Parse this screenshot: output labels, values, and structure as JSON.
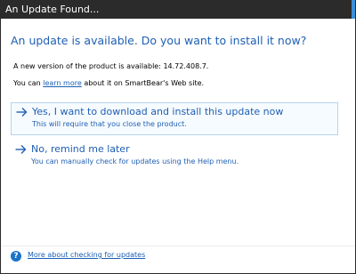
{
  "window": {
    "title": "An Update Found..."
  },
  "content": {
    "heading": "An update is available. Do you want to install it now?",
    "version_text": "A new version of the product is available: 14.72.408.7.",
    "learn_prefix": "You can ",
    "learn_link": "learn more",
    "learn_suffix": " about it on SmartBear's Web site."
  },
  "options": [
    {
      "title": "Yes, I want to download and install this update now",
      "subtitle": "This will require that you close the product.",
      "icon": "arrow-right-icon"
    },
    {
      "title": "No, remind me later",
      "subtitle": "You can manually check for updates using the Help menu.",
      "icon": "arrow-right-icon"
    }
  ],
  "footer": {
    "help_icon": "help-icon",
    "link": "More about checking for updates"
  },
  "colors": {
    "title_bar": "#2b2b2b",
    "accent": "#1f5fb3",
    "highlight_border": "#b7d2ee"
  }
}
